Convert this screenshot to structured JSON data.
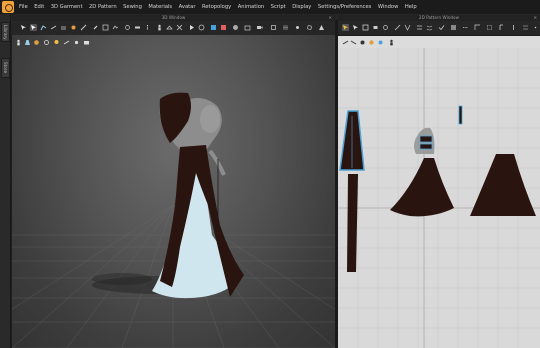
{
  "menu": [
    "File",
    "Edit",
    "3D Garment",
    "2D Pattern",
    "Sewing",
    "Materials",
    "Avatar",
    "Retopology",
    "Animation",
    "Script",
    "Display",
    "Settings/Preferences",
    "Window",
    "Help"
  ],
  "side_tabs": [
    "Library",
    "Store"
  ],
  "panels": {
    "left_title": "3D Window",
    "right_title": "2D Pattern Window"
  },
  "colors": {
    "garment_dark": "#2a1410",
    "garment_light": "#cfe6ee",
    "pattern_outline": "#4aa3d8",
    "app_accent": "#f2a33a"
  }
}
